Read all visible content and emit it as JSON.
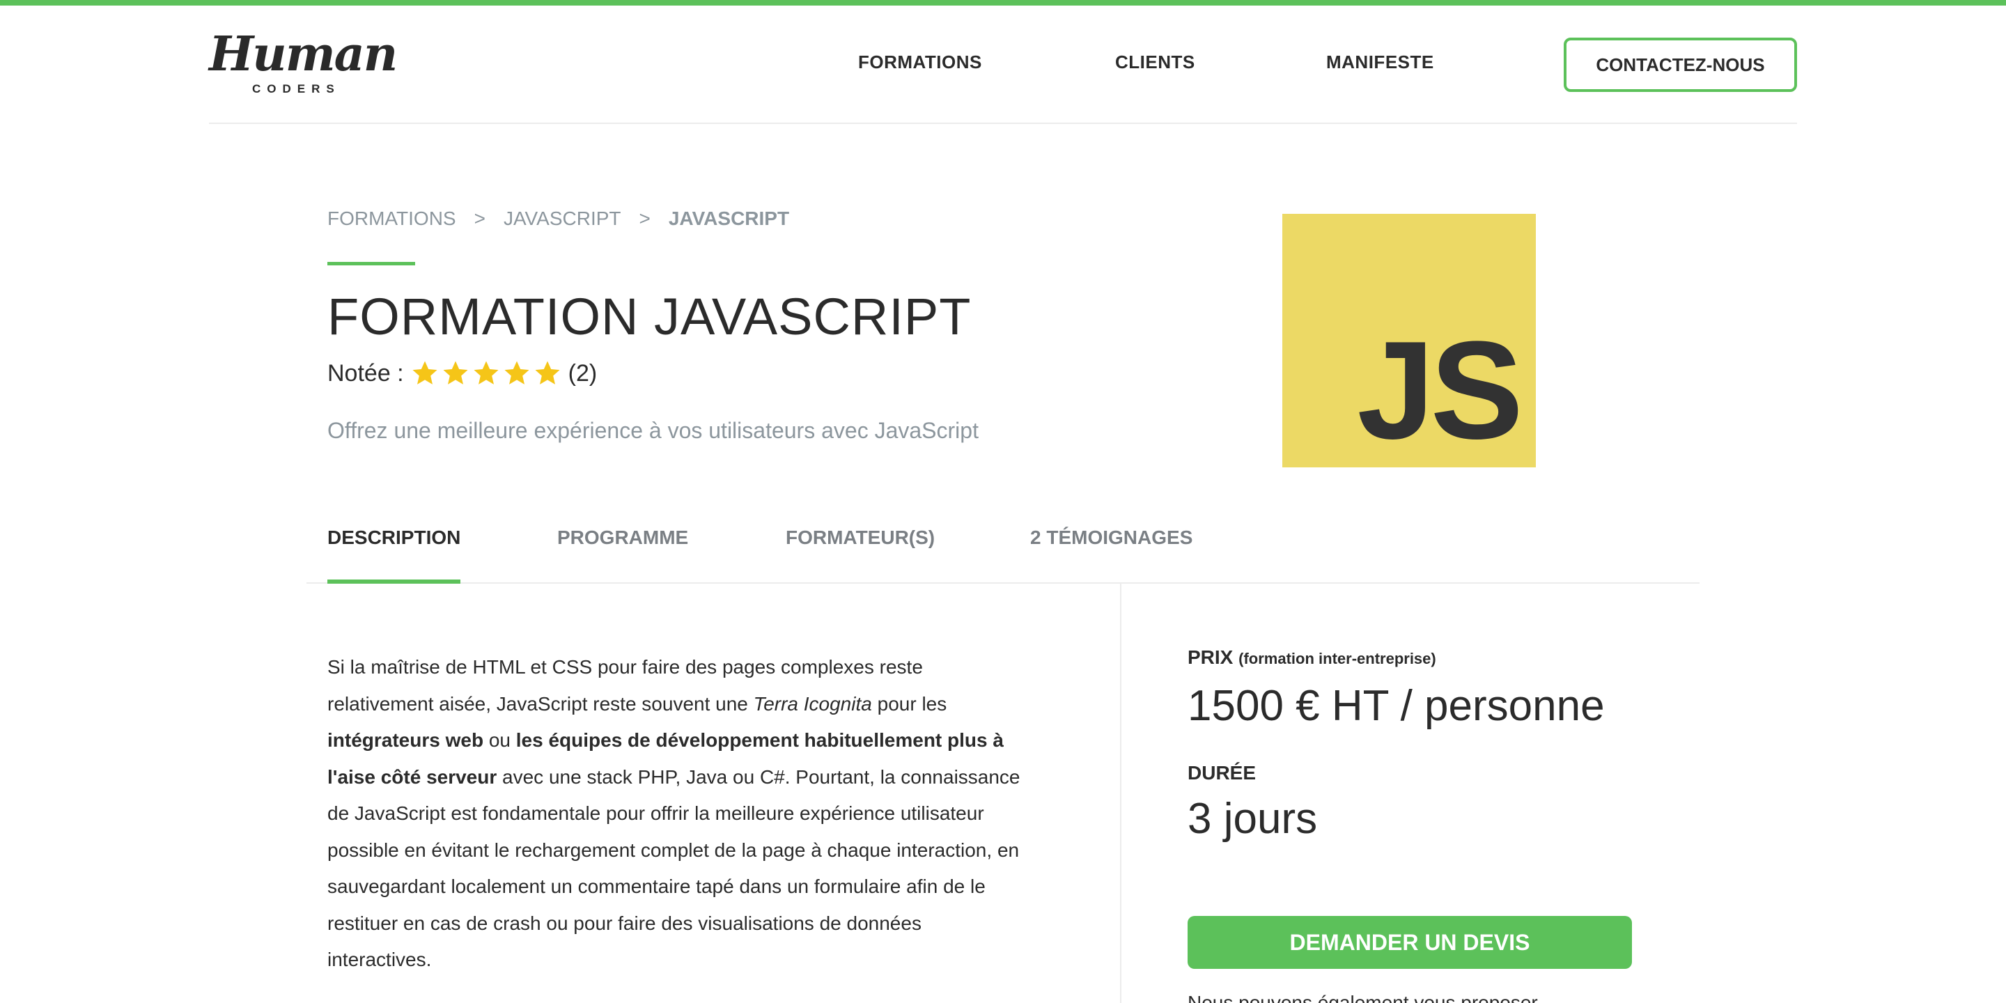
{
  "header": {
    "logo": {
      "main": "Human",
      "sub": "CODERS"
    },
    "nav": [
      "FORMATIONS",
      "CLIENTS",
      "MANIFESTE"
    ],
    "contact_label": "CONTACTEZ-NOUS"
  },
  "breadcrumb": {
    "items": [
      "FORMATIONS",
      "JAVASCRIPT"
    ],
    "current": "JAVASCRIPT",
    "separator": ">"
  },
  "hero": {
    "title": "FORMATION JAVASCRIPT",
    "rating_label": "Notée :",
    "stars": 5,
    "rating_count": "(2)",
    "subtitle": "Offrez une meilleure expérience à vos utilisateurs avec JavaScript",
    "logo_text": "JS"
  },
  "tabs": [
    "DESCRIPTION",
    "PROGRAMME",
    "FORMATEUR(S)",
    "2 TÉMOIGNAGES"
  ],
  "description": {
    "p1": "Si la maîtrise de HTML et CSS pour faire des pages complexes reste relativement aisée, JavaScript reste souvent une ",
    "em": "Terra Icognita",
    "p2": " pour les ",
    "b1": "intégrateurs web",
    "p3": " ou ",
    "b2": "les équipes de développement habituellement plus à l'aise côté serveur",
    "p4": " avec une stack PHP, Java ou C#. Pourtant, la connaissance de JavaScript est fondamentale pour offrir la meilleure expérience utilisateur possible en évitant le rechargement complet de la page à chaque interaction, en sauvegardant localement un commentaire tapé dans un formulaire afin de le restituer en cas de crash ou pour faire des visualisations de données interactives."
  },
  "sidebar": {
    "price_label": "PRIX",
    "price_note": "(formation inter-entreprise)",
    "price_value": "1500 € HT / personne",
    "duration_label": "DURÉE",
    "duration_value": "3 jours",
    "cta_label": "DEMANDER UN DEVIS",
    "note": "Nous pouvons également vous proposer"
  },
  "colors": {
    "accent": "#5cc15a",
    "js_yellow": "#ecd965",
    "star": "#f5c518"
  }
}
